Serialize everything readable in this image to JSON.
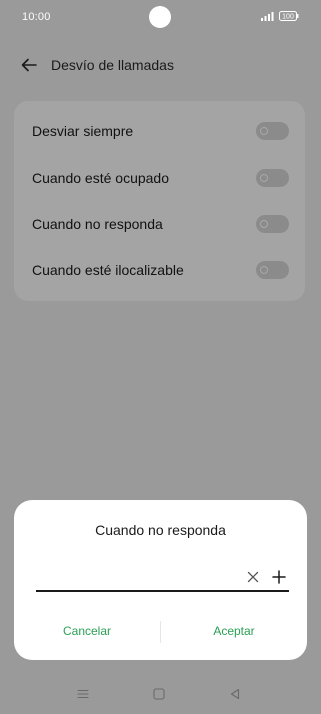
{
  "status_bar": {
    "time": "10:00",
    "battery": "100"
  },
  "header": {
    "back_icon": "arrow-left-icon",
    "title": "Desvío de llamadas"
  },
  "settings": {
    "items": [
      {
        "label": "Desviar siempre",
        "enabled": false
      },
      {
        "label": "Cuando esté ocupado",
        "enabled": false
      },
      {
        "label": "Cuando no responda",
        "enabled": false
      },
      {
        "label": "Cuando esté ilocalizable",
        "enabled": false
      }
    ]
  },
  "dialog": {
    "title": "Cuando no responda",
    "input_value": "",
    "clear_icon": "clear-icon",
    "add_icon": "add-contact-icon",
    "cancel_label": "Cancelar",
    "accept_label": "Aceptar"
  },
  "nav_bar": {
    "icons": [
      "menu-icon",
      "home-icon",
      "back-icon"
    ]
  },
  "colors": {
    "accent": "#2a9f55",
    "scrim": "#9a9a9a",
    "card": "#a4a4a4",
    "dialog": "#ffffff"
  }
}
